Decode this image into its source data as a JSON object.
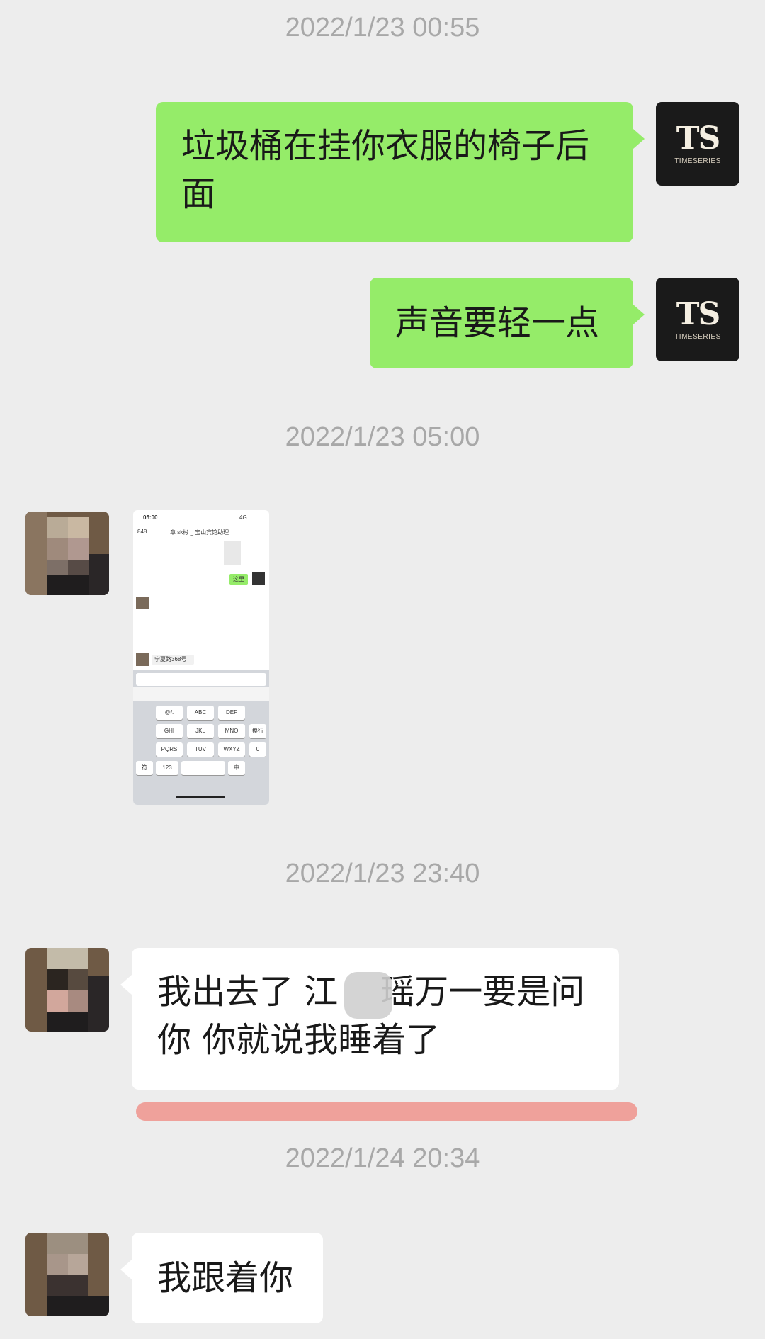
{
  "messages": {
    "ts1": "2022/1/23 00:55",
    "msg1_line1": "垃圾桶在挂你衣服的椅子后",
    "msg1_line2": "面",
    "msg2": "声音要轻一点",
    "ts2": "2022/1/23 05:00",
    "ts3": "2022/1/23 23:40",
    "msg4_part1": "我出去了 江",
    "msg4_part2": "瑶万一要是问",
    "msg4_line2": "你 你就说我睡着了",
    "ts4": "2022/1/24 20:34",
    "msg5": "我跟着你"
  },
  "avatar_self": {
    "mark": "TS",
    "word": "TIMESERIES"
  },
  "mini_screenshot": {
    "status_time": "05:00",
    "status_signal": "4G",
    "back_label": "848",
    "title": "章 sk彬 _ 宝山宾馆助理",
    "sent_label": "这里",
    "location_label": "宁夏路368号",
    "keys_row1": [
      "@/.",
      "ABC",
      "DEF"
    ],
    "keys_row2": [
      "GHI",
      "JKL",
      "MNO"
    ],
    "keys_row3": [
      "PQRS",
      "TUV",
      "WXYZ"
    ],
    "side_keys": [
      "换行",
      "0"
    ],
    "bottom_keys": [
      "符",
      "123",
      "中"
    ]
  },
  "colors": {
    "background": "#ededed",
    "outgoing_bubble": "#95ec69",
    "incoming_bubble": "#ffffff",
    "timestamp_text": "#a8a8a8",
    "highlight": "#f0786e"
  }
}
